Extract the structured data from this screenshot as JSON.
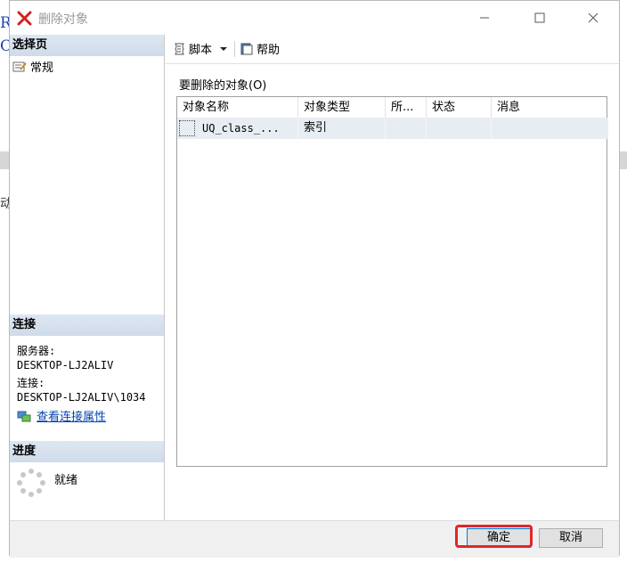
{
  "background": {
    "letters": [
      "R",
      "C"
    ],
    "side_char": "动"
  },
  "window": {
    "title": "删除对象",
    "controls": [
      "minimize",
      "maximize",
      "close"
    ]
  },
  "left_pane": {
    "select_page": {
      "header": "选择页",
      "items": [
        {
          "label": "常规",
          "icon": "properties-icon"
        }
      ]
    },
    "connection": {
      "header": "连接",
      "server_label": "服务器:",
      "server_value": "DESKTOP-LJ2ALIV",
      "connection_label": "连接:",
      "connection_value": "DESKTOP-LJ2ALIV\\1034",
      "view_properties_link": "查看连接属性"
    },
    "progress": {
      "header": "进度",
      "status": "就绪"
    }
  },
  "toolbar": {
    "script_label": "脚本",
    "help_label": "帮助"
  },
  "main": {
    "group_label": "要删除的对象(O)",
    "columns": [
      "对象名称",
      "对象类型",
      "所...",
      "状态",
      "消息"
    ],
    "rows": [
      {
        "name": "UQ_class_...",
        "type": "索引",
        "owner": "",
        "status": "",
        "message": ""
      }
    ]
  },
  "footer": {
    "ok_label": "确定",
    "cancel_label": "取消"
  },
  "colors": {
    "highlight": "#e0262b",
    "section_header": "#cfdbe9",
    "link": "#0645ad",
    "row_bg": "#e8edf3"
  }
}
